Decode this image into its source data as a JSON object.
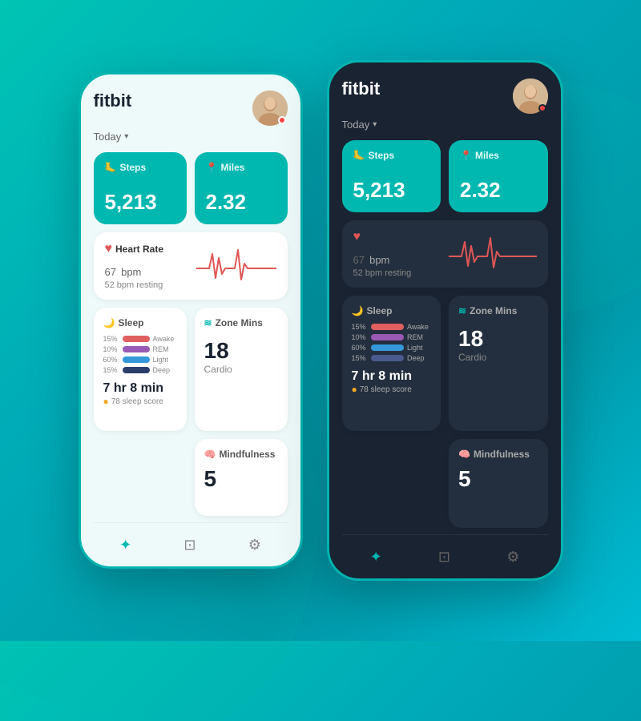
{
  "background": {
    "color": "#00c4b4"
  },
  "light_phone": {
    "brand": "fitbit",
    "today_label": "Today",
    "avatar_alt": "user avatar",
    "steps_label": "Steps",
    "steps_value": "5,213",
    "miles_label": "Miles",
    "miles_value": "2.32",
    "heart_rate_label": "Heart Rate",
    "heart_rate_value": "67",
    "heart_rate_unit": "bpm",
    "heart_rate_resting": "52 bpm resting",
    "sleep_label": "Sleep",
    "sleep_bars": [
      {
        "pct": "15%",
        "label": "Awake",
        "color": "#e06060",
        "width": "15%"
      },
      {
        "pct": "10%",
        "label": "REM",
        "color": "#9b59b6",
        "width": "10%"
      },
      {
        "pct": "60%",
        "label": "Light",
        "color": "#3498db",
        "width": "60%"
      },
      {
        "pct": "15%",
        "label": "Deep",
        "color": "#2c3e6e",
        "width": "15%"
      }
    ],
    "sleep_time": "7 hr 8 min",
    "sleep_score_label": "78 sleep score",
    "zone_mins_label": "Zone Mins",
    "zone_mins_value": "18",
    "zone_mins_sub": "Cardio",
    "mindfulness_label": "Mindfulness",
    "mindfulness_value": "5",
    "nav_items": [
      "apps",
      "activity",
      "settings"
    ]
  },
  "dark_phone": {
    "brand": "fitbit",
    "today_label": "Today",
    "avatar_alt": "user avatar",
    "steps_label": "Steps",
    "steps_value": "5,213",
    "miles_label": "Miles",
    "miles_value": "2.32",
    "heart_rate_label": "Heart Rate",
    "heart_rate_value": "67",
    "heart_rate_unit": "bpm",
    "heart_rate_resting": "52 bpm resting",
    "sleep_label": "Sleep",
    "sleep_bars": [
      {
        "pct": "15%",
        "label": "Awake",
        "color": "#e06060",
        "width": "15%"
      },
      {
        "pct": "10%",
        "label": "REM",
        "color": "#9b59b6",
        "width": "10%"
      },
      {
        "pct": "60%",
        "label": "Light",
        "color": "#3498db",
        "width": "60%"
      },
      {
        "pct": "15%",
        "label": "Deep",
        "color": "#2c3e6e",
        "width": "15%"
      }
    ],
    "sleep_time": "7 hr 8 min",
    "sleep_score_label": "78 sleep score",
    "zone_mins_label": "Zone Mins",
    "zone_mins_value": "18",
    "zone_mins_sub": "Cardio",
    "mindfulness_label": "Mindfulness",
    "mindfulness_value": "5",
    "nav_items": [
      "apps",
      "activity",
      "settings"
    ]
  }
}
